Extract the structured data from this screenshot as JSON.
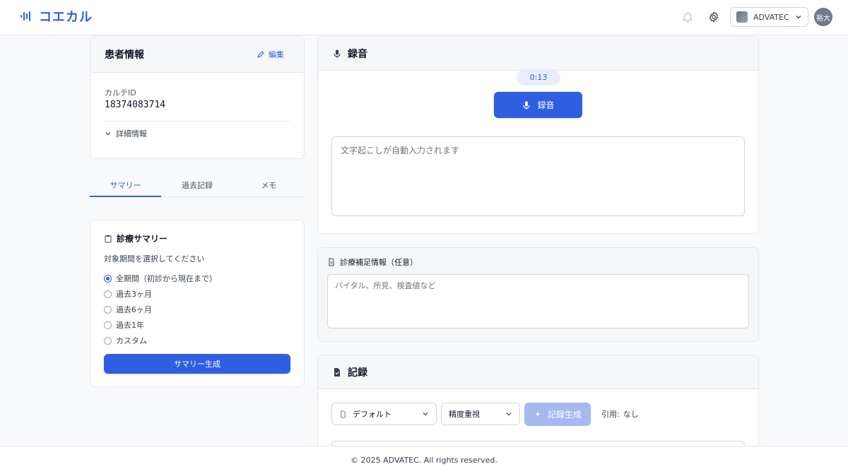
{
  "header": {
    "app_name": "コエカル",
    "org_name": "ADVATEC",
    "avatar_text": "裕大",
    "icons": [
      "waveform-logo-icon",
      "bell-icon",
      "gear-icon",
      "chevron-down-icon"
    ]
  },
  "patient": {
    "title": "患者情報",
    "edit_label": "編集",
    "karte_id_label": "カルテID",
    "karte_id_value": "18374083714",
    "details_toggle": "詳細情報"
  },
  "tabs": [
    {
      "label": "サマリー",
      "active": true
    },
    {
      "label": "過去記録",
      "active": false
    },
    {
      "label": "メモ",
      "active": false
    }
  ],
  "summary": {
    "title": "診療サマリー",
    "prompt": "対象期間を選択してください",
    "options": [
      {
        "label": "全期間（初診から現在まで）",
        "checked": true
      },
      {
        "label": "過去3ヶ月",
        "checked": false
      },
      {
        "label": "過去6ヶ月",
        "checked": false
      },
      {
        "label": "過去1年",
        "checked": false
      },
      {
        "label": "カスタム",
        "checked": false
      }
    ],
    "generate_label": "サマリー生成"
  },
  "recording": {
    "title": "録音",
    "timer": "0:13",
    "record_label": "録音",
    "transcript_placeholder": "文字起こしが自動入力されます"
  },
  "supplement": {
    "title": "診療補足情報（任意）",
    "placeholder": "バイタル、所見、検査値など"
  },
  "record": {
    "title": "記録",
    "template_value": "デフォルト",
    "mode_value": "精度重視",
    "generate_label": "記録生成",
    "citation_label": "引用:",
    "citation_value": "なし"
  },
  "footer": {
    "copyright": "© 2025 ADVATEC. All rights reserved."
  },
  "colors": {
    "accent": "#2f5fe0",
    "accent_disabled": "#a5b8f0",
    "border": "#e5e7eb"
  }
}
